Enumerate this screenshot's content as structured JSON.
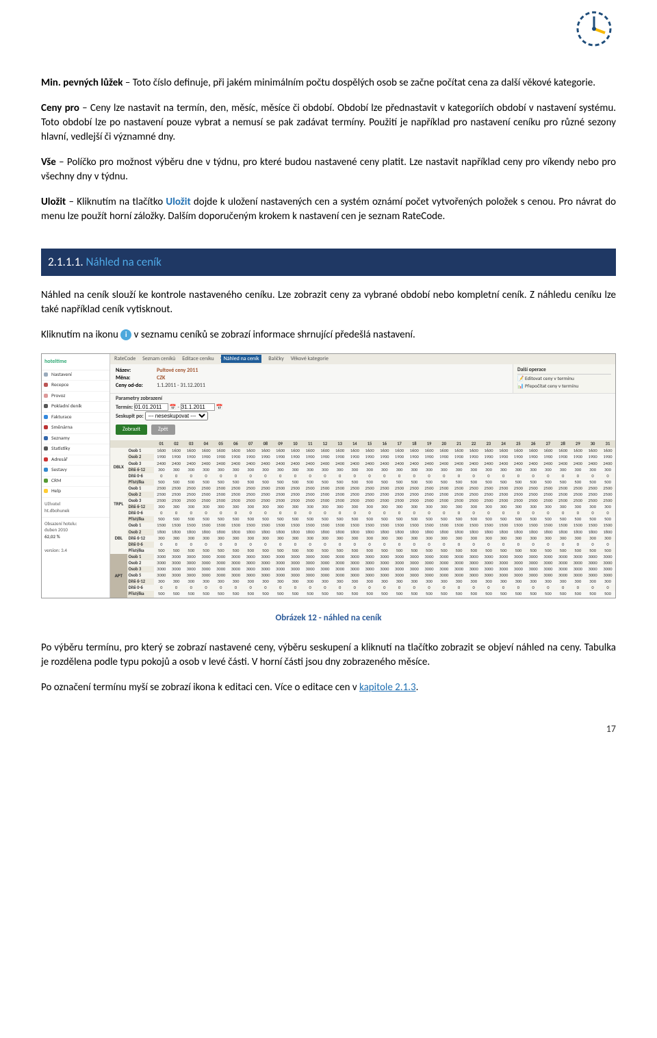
{
  "body": {
    "p1_label": "Min. pevných lůžek",
    "p1_text": " – Toto číslo definuje, při jakém minimálním počtu dospělých osob se začne počítat cena za další věkové kategorie.",
    "p2_label": "Ceny pro",
    "p2_text": " – Ceny lze nastavit na termín, den, měsíc, měsíce či období. Období lze přednastavit v kategoriích období v nastavení systému. Toto období lze po nastavení pouze vybrat a nemusí se pak zadávat termíny. Použití je například pro nastavení ceníku pro různé sezony hlavní, vedlejší či významné dny.",
    "p3_label": "Vše",
    "p3_text": " – Políčko pro možnost výběru dne v týdnu, pro které budou nastavené ceny platit. Lze nastavit například ceny pro víkendy nebo pro všechny dny v týdnu.",
    "p4_label": "Uložit",
    "p4_a": " – Kliknutím na tlačítko ",
    "p4_link": "Uložit",
    "p4_b": " dojde k uložení nastavených cen a systém oznámí počet vytvořených položek s cenou. Pro návrat do menu lze použít horní záložky. Dalším doporučeným krokem k nastavení cen je seznam RateCode."
  },
  "section": {
    "num": "2.1.1.1.",
    "title": "Náhled na ceník"
  },
  "body2": {
    "p1": "Náhled na ceník slouží ke kontrole nastaveného ceníku. Lze zobrazit ceny za vybrané období nebo kompletní ceník. Z náhledu ceníku lze také například ceník vytisknout.",
    "p2a": "Kliknutím na ikonu ",
    "p2b": " v seznamu ceníků se zobrazí informace shrnující předešlá nastavení."
  },
  "screenshot": {
    "logo": "hoteltime",
    "menu": [
      "Nastavení",
      "Recepce",
      "Provoz",
      "Pokladní deník",
      "Fakturace",
      "Směnárna",
      "Seznamy",
      "Statistiky",
      "Adresář",
      "Sestavy",
      "CRM",
      "Help"
    ],
    "user_label": "Uživatel",
    "user_name": "ht.dbohunek",
    "obs_label": "Obsazení hotelu:",
    "obs_line2": "duben 2010",
    "obs_val": "62,02 %",
    "version": "version: 3.4",
    "tabs": [
      "RateCode",
      "Seznam ceníků",
      "Editace ceníku",
      "Náhled na ceník",
      "Balíčky",
      "Věkové kategorie"
    ],
    "info_name_l": "Název:",
    "info_name_v": "Pultové ceny 2011",
    "info_curr_l": "Měna:",
    "info_curr_v": "CZK",
    "info_dates_l": "Ceny od-do:",
    "info_dates_v": "1.1.2011 - 31.12.2011",
    "side_ops_title": "Další operace",
    "side_op1": "Editovat ceny v termínu",
    "side_op2": "Přepočítat ceny v termínu",
    "params_title": "Parametry zobrazení",
    "params_term": "Termín:",
    "params_term_a": "01.01.2011",
    "params_term_b": "31.1.2011",
    "params_group": "Seskupit po:",
    "params_group_v": "--- neseskupovat ---",
    "btn_show": "Zobrazit",
    "btn_back": "Zpět",
    "room_types": [
      "DBLX",
      "TRPL",
      "DBL",
      "APT"
    ],
    "row_labels": [
      "Osob 1",
      "Osob 2",
      "Osob 3",
      "Dítě 6-12",
      "Dítě 0-6",
      "Přistýlka"
    ],
    "osob5": "Osob 5",
    "chart_data": {
      "type": "table",
      "title": "Náhled na ceník – leden 2011",
      "days": [
        1,
        2,
        3,
        4,
        5,
        6,
        7,
        8,
        9,
        10,
        11,
        12,
        13,
        14,
        15,
        16,
        17,
        18,
        19,
        20,
        21,
        22,
        23,
        24,
        25,
        26,
        27,
        28,
        29,
        30,
        31
      ],
      "rooms": [
        {
          "code": "DBLX",
          "rows": [
            {
              "label": "Osob 1",
              "v": 1600
            },
            {
              "label": "Osob 2",
              "v": 1900
            },
            {
              "label": "Osob 3",
              "v": 2400
            },
            {
              "label": "Dítě 6-12",
              "v": 300
            },
            {
              "label": "Dítě 0-6",
              "v": 0
            },
            {
              "label": "Přistýlka",
              "v": 500
            }
          ]
        },
        {
          "code": "TRPL",
          "rows": [
            {
              "label": "Osob 1",
              "v": 2500
            },
            {
              "label": "Osob 2",
              "v": 2500
            },
            {
              "label": "Osob 3",
              "v": 2500
            },
            {
              "label": "Dítě 6-12",
              "v": 300
            },
            {
              "label": "Dítě 0-6",
              "v": 0
            },
            {
              "label": "Přistýlka",
              "v": 500
            }
          ]
        },
        {
          "code": "DBL",
          "rows": [
            {
              "label": "Osob 1",
              "v": 1500
            },
            {
              "label": "Osob 2",
              "v": 1800
            },
            {
              "label": "Dítě 6-12",
              "v": 300
            },
            {
              "label": "Dítě 0-6",
              "v": 0
            },
            {
              "label": "Přistýlka",
              "v": 500
            }
          ]
        },
        {
          "code": "APT",
          "rows": [
            {
              "label": "Osob 1",
              "v": 3000
            },
            {
              "label": "Osob 2",
              "v": 3000
            },
            {
              "label": "Osob 3",
              "v": 3000
            },
            {
              "label": "Osob 5",
              "v": 3000
            },
            {
              "label": "Dítě 6-12",
              "v": 300
            },
            {
              "label": "Dítě 0-6",
              "v": 0
            },
            {
              "label": "Přistýlka",
              "v": 500
            }
          ]
        }
      ]
    }
  },
  "caption": "Obrázek 12 - náhled na ceník",
  "body3": {
    "p1": "Po výběru termínu, pro který se zobrazí nastavené ceny, výběru seskupení a kliknutí na tlačítko zobrazit se objeví náhled na ceny. Tabulka je rozdělena podle typu pokojů a osob v levé části. V horní části jsou dny zobrazeného měsíce.",
    "p2a": "Po označení termínu myší se zobrazí ikona k editaci cen. Více o editace cen v ",
    "p2link": "kapitole 2.1.3",
    "p2b": "."
  },
  "page_num": "17"
}
